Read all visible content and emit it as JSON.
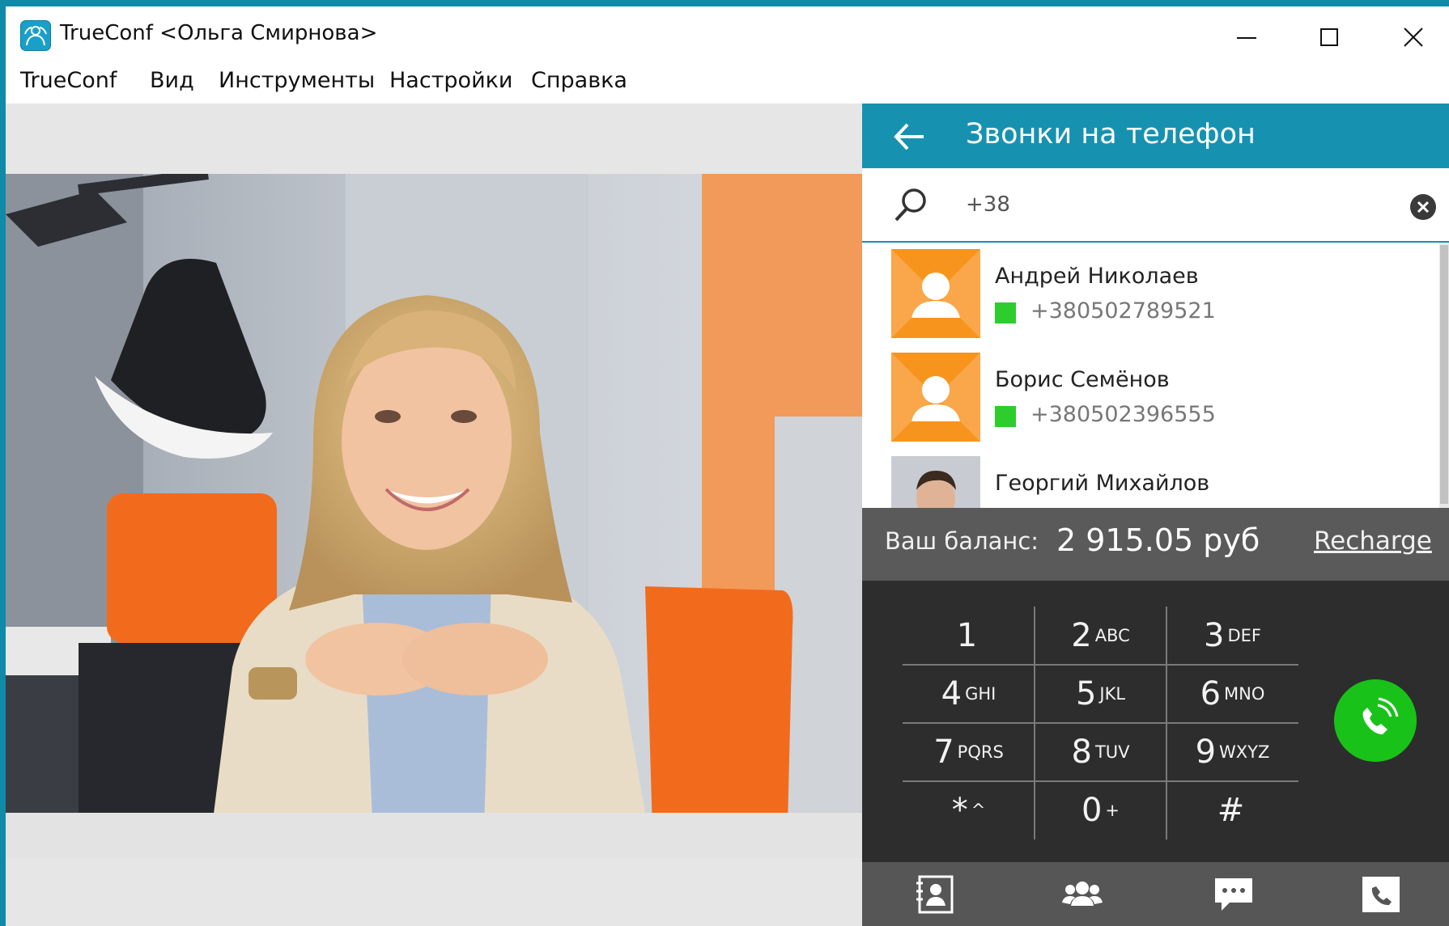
{
  "window": {
    "title": "TrueConf <Ольга Смирнова>",
    "controls": [
      "minimize-icon",
      "maximize-icon",
      "close-icon"
    ]
  },
  "menu": {
    "items": [
      "TrueConf",
      "Вид",
      "Инструменты",
      "Настройки",
      "Справка"
    ]
  },
  "panel": {
    "title": "Звонки на телефон",
    "back_icon": "arrow-left-icon",
    "search": {
      "value": "+38",
      "icon": "search-icon",
      "clear_icon": "clear-circle-icon"
    },
    "contacts": [
      {
        "name": "Андрей Николаев",
        "phone": "+380502789521",
        "avatar": "default-avatar-icon"
      },
      {
        "name": "Борис Семёнов",
        "phone": "+380502396555",
        "avatar": "default-avatar-icon"
      },
      {
        "name": "Георгий Михайлов",
        "avatar": "photo-avatar"
      }
    ],
    "balance": {
      "label": "Ваш баланс:",
      "value": "2 915.05 руб",
      "action": "Recharge"
    },
    "dialpad": {
      "keys": [
        {
          "digit": "1",
          "letters": ""
        },
        {
          "digit": "2",
          "letters": "ABC"
        },
        {
          "digit": "3",
          "letters": "DEF"
        },
        {
          "digit": "4",
          "letters": "GHI"
        },
        {
          "digit": "5",
          "letters": "JKL"
        },
        {
          "digit": "6",
          "letters": "MNO"
        },
        {
          "digit": "7",
          "letters": "PQRS"
        },
        {
          "digit": "8",
          "letters": "TUV"
        },
        {
          "digit": "9",
          "letters": "WXYZ"
        },
        {
          "digit": "*",
          "letters": "^"
        },
        {
          "digit": "0",
          "letters": "+"
        },
        {
          "digit": "#",
          "letters": ""
        }
      ],
      "call_icon": "phone-call-icon"
    },
    "bottom_nav": [
      "contacts-book-icon",
      "group-icon",
      "chat-icon",
      "phone-icon"
    ]
  },
  "colors": {
    "accent": "#1692b0",
    "status_online": "#2ccd2c",
    "call_button": "#19c219",
    "avatar_orange": "#f7941d",
    "dialpad_bg": "#2d2d2d",
    "balance_bg": "#5a5a5a"
  }
}
